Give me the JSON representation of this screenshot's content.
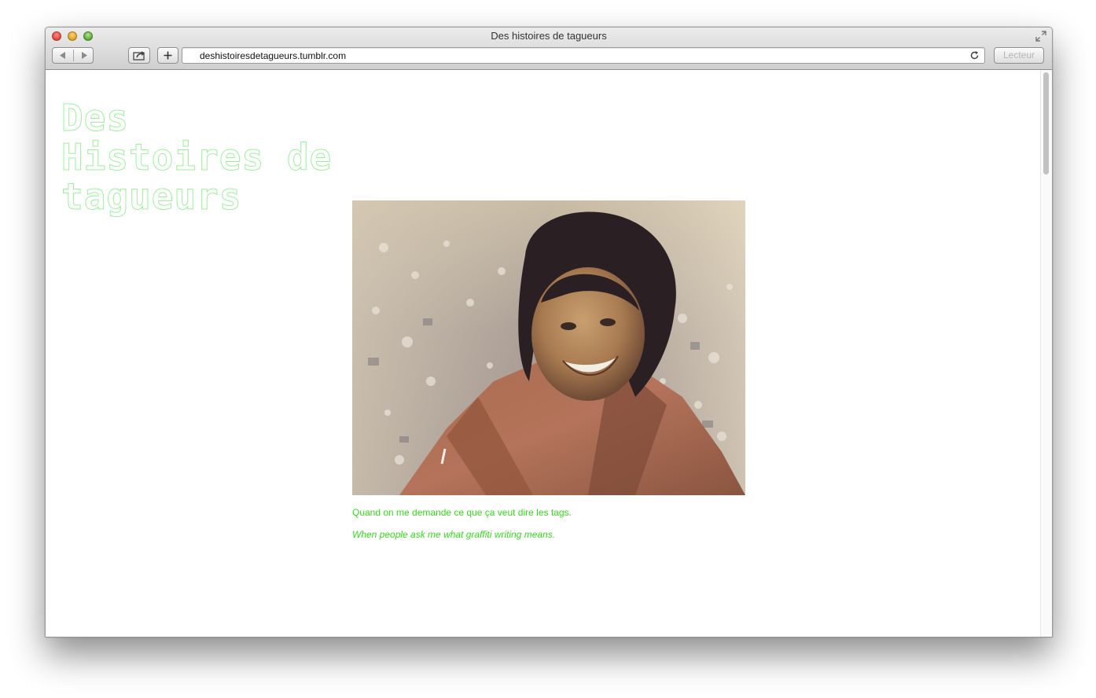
{
  "window": {
    "title": "Des histoires de tagueurs",
    "controls": [
      "close-icon",
      "minimize-icon",
      "maximize-icon"
    ],
    "fullscreen_icon": "fullscreen-icon"
  },
  "toolbar": {
    "back_icon": "back-arrow-icon",
    "forward_icon": "forward-arrow-icon",
    "share_icon": "share-icon",
    "new_tab_icon": "plus-icon",
    "url": "deshistoiresdetagueurs.tumblr.com",
    "reload_icon": "reload-icon",
    "reader_label": "Lecteur"
  },
  "blog": {
    "title": "Des Histoires de tagueurs",
    "title_color": "#9bf29b",
    "caption_color": "#33dd1a"
  },
  "post": {
    "caption_fr": "Quand on me demande ce que ça veut dire les tags.",
    "caption_en": "When people ask me what graffiti writing means."
  }
}
